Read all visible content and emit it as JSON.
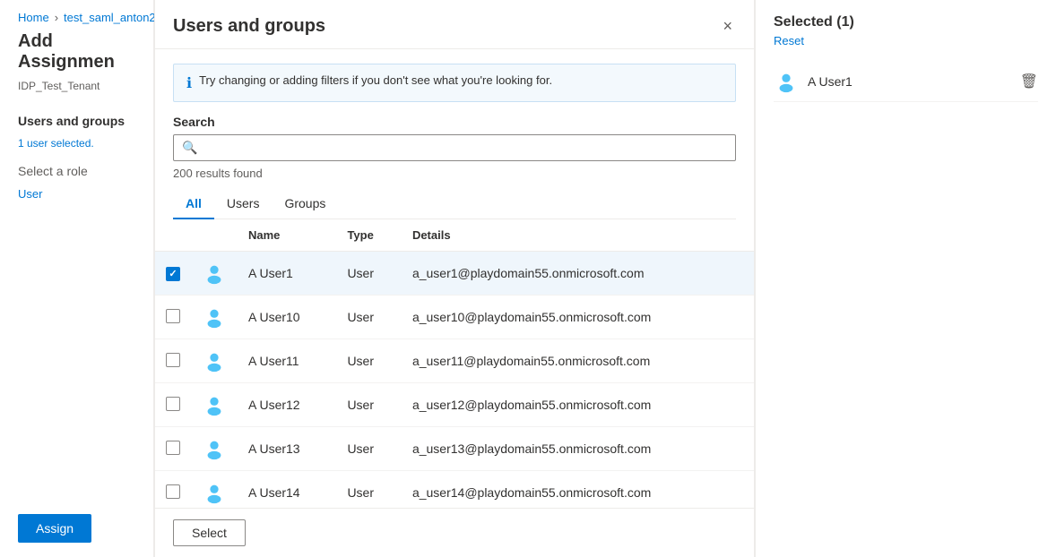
{
  "breadcrumb": {
    "home": "Home",
    "separator": "›",
    "item": "test_saml_anton2"
  },
  "left_panel": {
    "title": "Add Assignmen",
    "subtitle": "IDP_Test_Tenant",
    "nav_items": [
      {
        "label": "Users and groups",
        "sub": "1 user selected.",
        "active": true
      },
      {
        "label": "Select a role",
        "sub": "User"
      }
    ],
    "assign_button": "Assign"
  },
  "modal": {
    "title": "Users and groups",
    "close_label": "×",
    "info_text": "Try changing or adding filters if you don't see what you're looking for.",
    "search_label": "Search",
    "search_placeholder": "",
    "results_count": "200 results found",
    "tabs": [
      {
        "label": "All",
        "active": true
      },
      {
        "label": "Users",
        "active": false
      },
      {
        "label": "Groups",
        "active": false
      }
    ],
    "columns": [
      {
        "label": ""
      },
      {
        "label": ""
      },
      {
        "label": "Name"
      },
      {
        "label": "Type"
      },
      {
        "label": "Details"
      }
    ],
    "rows": [
      {
        "checked": true,
        "name": "A User1",
        "type": "User",
        "details": "a_user1@playdomain55.onmicrosoft.com",
        "selected": true
      },
      {
        "checked": false,
        "name": "A User10",
        "type": "User",
        "details": "a_user10@playdomain55.onmicrosoft.com",
        "selected": false
      },
      {
        "checked": false,
        "name": "A User11",
        "type": "User",
        "details": "a_user11@playdomain55.onmicrosoft.com",
        "selected": false
      },
      {
        "checked": false,
        "name": "A User12",
        "type": "User",
        "details": "a_user12@playdomain55.onmicrosoft.com",
        "selected": false
      },
      {
        "checked": false,
        "name": "A User13",
        "type": "User",
        "details": "a_user13@playdomain55.onmicrosoft.com",
        "selected": false
      },
      {
        "checked": false,
        "name": "A User14",
        "type": "User",
        "details": "a_user14@playdomain55.onmicrosoft.com",
        "selected": false
      }
    ],
    "select_button": "Select"
  },
  "right_panel": {
    "header": "Selected (1)",
    "reset_label": "Reset",
    "selected_users": [
      {
        "name": "A User1"
      }
    ]
  }
}
